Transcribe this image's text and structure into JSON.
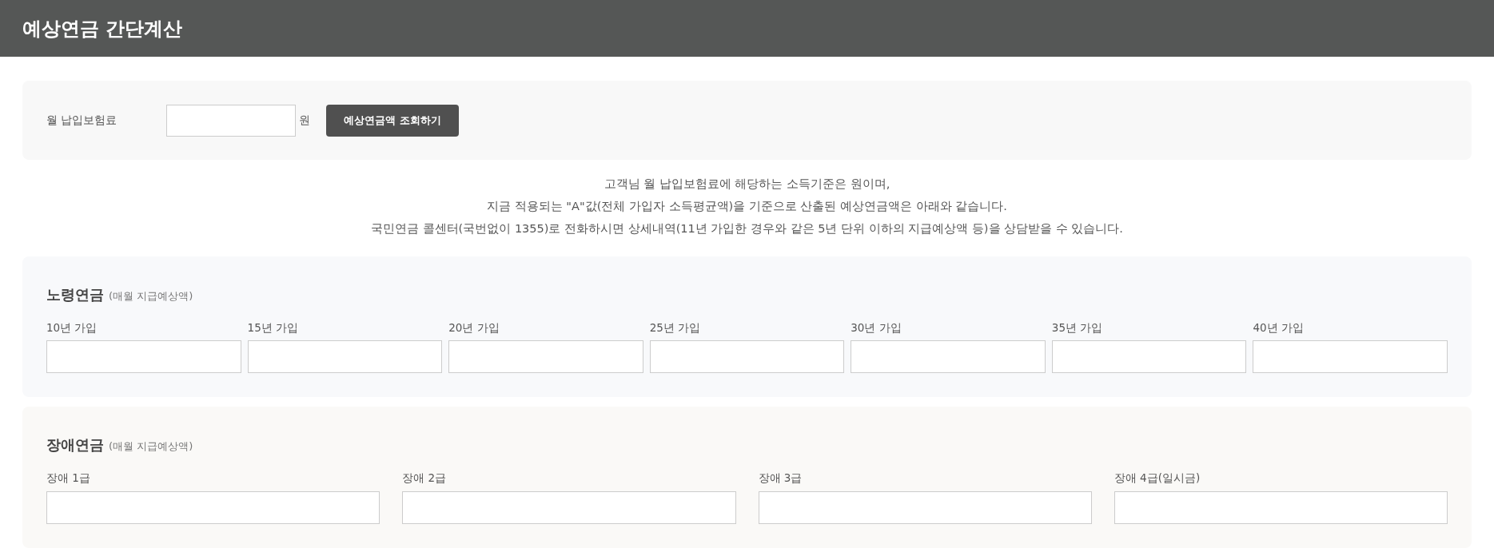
{
  "header": {
    "title": "예상연금 간단계산"
  },
  "premium_form": {
    "label": "월 납입보험료",
    "unit": "원",
    "button": "예상연금액 조회하기"
  },
  "notice": [
    "고객님 월 납입보험료에 해당하는 소득기준은 원이며,",
    "지금 적용되는 \"A\"값(전체 가입자 소득평균액)을 기준으로 산출된 예상연금액은 아래와 같습니다.",
    "국민연금 콜센터(국번없이 1355)로 전화하시면 상세내역(11년 가입한 경우와 같은 5년 단위 이하의 지급예상액 등)을 상담받을 수 있습니다."
  ],
  "sections": [
    {
      "title": "노령연금",
      "subtitle": "(매월 지급예상액)",
      "fields": [
        {
          "label": "10년 가입"
        },
        {
          "label": "15년 가입"
        },
        {
          "label": "20년 가입"
        },
        {
          "label": "25년 가입"
        },
        {
          "label": "30년 가입"
        },
        {
          "label": "35년 가입"
        },
        {
          "label": "40년 가입"
        }
      ]
    },
    {
      "title": "장애연금",
      "subtitle": "(매월 지급예상액)",
      "fields": [
        {
          "label": "장애 1급"
        },
        {
          "label": "장애 2급"
        },
        {
          "label": "장애 3급"
        },
        {
          "label": "장애 4급(일시금)"
        }
      ]
    }
  ]
}
